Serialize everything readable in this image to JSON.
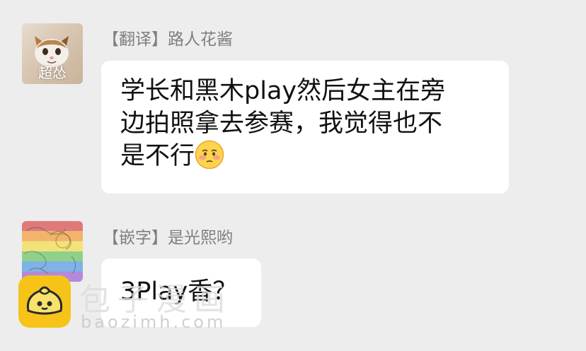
{
  "messages": [
    {
      "sender": "【翻译】路人花酱",
      "avatar_caption": "超怂",
      "avatar_icon": "cat-avatar-icon",
      "text_lines": [
        "学长和黑木play然后女主在旁",
        "边拍照拿去参赛，我觉得也不",
        "是不行"
      ],
      "emoji": "flushed-face-emoji"
    },
    {
      "sender": "【嵌字】是光熙哟",
      "avatar_icon": "rainbow-avatar-icon",
      "text": "3Play香？"
    }
  ],
  "watermark": {
    "title": "包子漫画",
    "url": "baozimh.com",
    "logo_icon": "bun-logo-icon"
  },
  "colors": {
    "background": "#ededed",
    "bubble": "#ffffff",
    "sender_name": "#7f7f7f",
    "message_text": "#111111",
    "logo": "#f6c318"
  }
}
